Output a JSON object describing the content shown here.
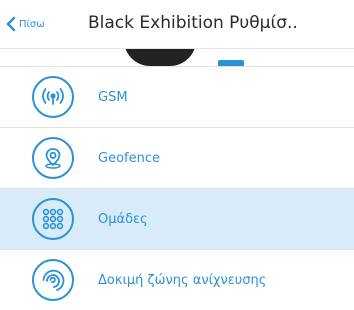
{
  "nav": {
    "back_label": "Πίσω",
    "title": "Black Exhibition Ρυθμίσ.."
  },
  "menu": {
    "items": [
      {
        "label": "GSM",
        "icon": "broadcast-icon",
        "selected": false
      },
      {
        "label": "Geofence",
        "icon": "location-pin-icon",
        "selected": false
      },
      {
        "label": "Ομάδες",
        "icon": "groups-grid-icon",
        "selected": true
      },
      {
        "label": "Δοκιμή ζώνης ανίχνευσης",
        "icon": "detection-zone-icon",
        "selected": false
      }
    ]
  },
  "colors": {
    "accent": "#2a93d5",
    "selected_row": "#d8ebf8",
    "title_text": "#2b2b2b",
    "divider": "#e2e2e2"
  }
}
